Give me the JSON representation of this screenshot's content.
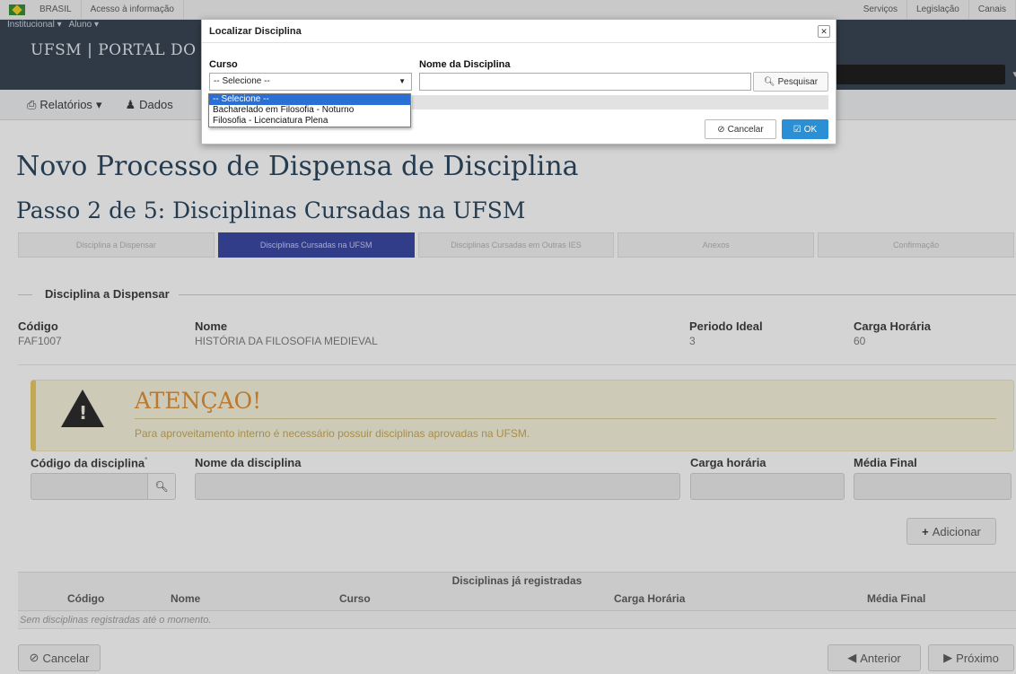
{
  "govbar": {
    "brasil": "BRASIL",
    "acesso": "Acesso à informação",
    "servicos": "Serviços",
    "legislacao": "Legislação",
    "canais": "Canais"
  },
  "header": {
    "menu_institucional": "Institucional ▾",
    "menu_aluno": "Aluno ▾",
    "portal_title": "UFSM | PORTAL DO ALUNO",
    "user_caret": "▾"
  },
  "navbar": {
    "relatorios": "Relatórios",
    "dados": "Dados"
  },
  "page": {
    "title": "Novo Processo de Dispensa de Disciplina",
    "step_title": "Passo 2 de 5: Disciplinas Cursadas na UFSM"
  },
  "wizard": {
    "steps": [
      "Disciplina a Dispensar",
      "Disciplinas Cursadas na UFSM",
      "Disciplinas Cursadas em Outras IES",
      "Anexos",
      "Confirmação"
    ]
  },
  "disciplina": {
    "legend": "Disciplina a Dispensar",
    "codigo_label": "Código",
    "codigo_value": "FAF1007",
    "nome_label": "Nome",
    "nome_value": "HISTÓRIA DA FILOSOFIA MEDIEVAL",
    "periodo_label": "Periodo Ideal",
    "periodo_value": "3",
    "carga_label": "Carga Horária",
    "carga_value": "60"
  },
  "alert": {
    "title": "ATENÇAO!",
    "text": "Para aproveitamento interno é necessário possuir disciplinas aprovadas na UFSM."
  },
  "form": {
    "codigo_label": "Código da disciplina",
    "codigo_req": "*",
    "nome_label": "Nome da disciplina",
    "carga_label": "Carga horária",
    "media_label": "Média Final",
    "adicionar": "Adicionar"
  },
  "table": {
    "caption": "Disciplinas já registradas",
    "columns": [
      "Código",
      "Nome",
      "Curso",
      "Carga Horária",
      "Média Final"
    ],
    "empty": "Sem disciplinas registradas até o momento."
  },
  "footer": {
    "cancelar": "Cancelar",
    "anterior": "Anterior",
    "proximo": "Próximo"
  },
  "modal": {
    "title": "Localizar Disciplina",
    "close": "✕",
    "curso_label": "Curso",
    "curso_value": "-- Selecione --",
    "nome_label": "Nome da Disciplina",
    "nome_value": "",
    "pesquisar": "Pesquisar",
    "cancelar": "Cancelar",
    "ok": "OK",
    "options": [
      "-- Selecione --",
      "Bacharelado em Filosofia - Noturno",
      "Filosofia - Licenciatura Plena"
    ]
  }
}
